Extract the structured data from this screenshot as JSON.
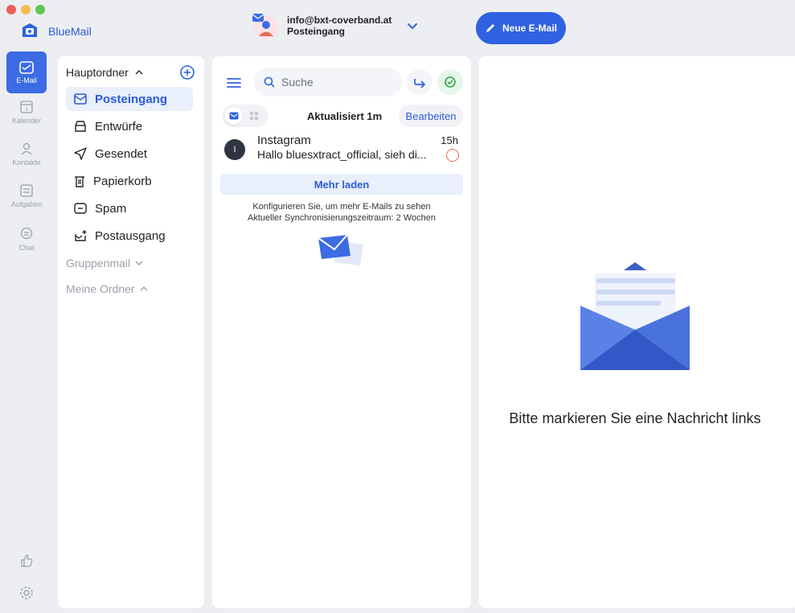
{
  "app": {
    "name": "BlueMail"
  },
  "account": {
    "email": "info@bxt-coverband.at",
    "folder": "Posteingang"
  },
  "compose": {
    "label": "Neue E-Mail"
  },
  "rail": {
    "items": [
      {
        "label": "E-Mail",
        "icon": "mail-icon"
      },
      {
        "label": "Kalender",
        "icon": "calendar-icon"
      },
      {
        "label": "Kontakte",
        "icon": "contacts-icon"
      },
      {
        "label": "Aufgaben",
        "icon": "tasks-icon"
      },
      {
        "label": "Chat",
        "icon": "chat-icon"
      }
    ],
    "bottom": [
      {
        "icon": "thumbs-up-icon"
      },
      {
        "icon": "gear-icon"
      }
    ]
  },
  "folders": {
    "header": "Hauptordner",
    "items": [
      {
        "label": "Posteingang",
        "icon": "inbox-icon"
      },
      {
        "label": "Entwürfe",
        "icon": "drafts-icon"
      },
      {
        "label": "Gesendet",
        "icon": "sent-icon"
      },
      {
        "label": "Papierkorb",
        "icon": "trash-icon"
      },
      {
        "label": "Spam",
        "icon": "spam-icon"
      },
      {
        "label": "Postausgang",
        "icon": "outbox-icon"
      }
    ],
    "groups": [
      "Gruppenmail",
      "Meine Ordner"
    ]
  },
  "list": {
    "search_placeholder": "Suche",
    "updated": "Aktualisiert 1m",
    "edit": "Bearbeiten",
    "messages": [
      {
        "initial": "I",
        "from": "Instagram",
        "time": "15h",
        "snippet": "Hallo bluesxtract_official, sieh di..."
      }
    ],
    "load_more": "Mehr laden",
    "hint_line1": "Konfigurieren Sie, um mehr E-Mails zu sehen",
    "hint_line2": "Aktueller Synchronisierungszeitraum: 2 Wochen"
  },
  "reader": {
    "empty_message": "Bitte markieren Sie eine Nachricht links"
  },
  "colors": {
    "accent": "#2f62e0",
    "rail_active": "#3c6be3",
    "background": "#eceef2"
  }
}
